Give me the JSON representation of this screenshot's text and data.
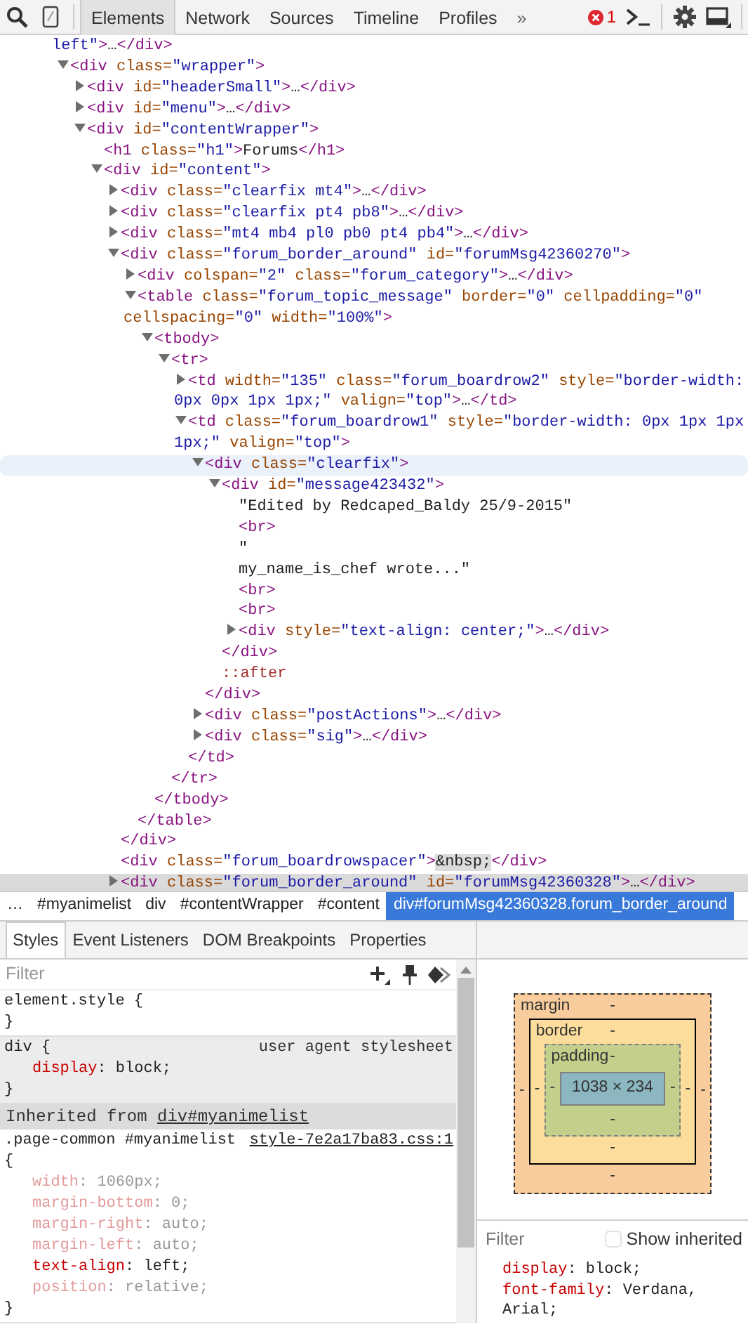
{
  "toolbar": {
    "tabs": [
      {
        "label": "Elements",
        "selected": true
      },
      {
        "label": "Network",
        "selected": false
      },
      {
        "label": "Sources",
        "selected": false
      },
      {
        "label": "Timeline",
        "selected": false
      },
      {
        "label": "Profiles",
        "selected": false
      }
    ],
    "overflow": "»",
    "error_count": "1"
  },
  "dom_tree": [
    {
      "kind": "fragment",
      "selected": false,
      "hovered": false,
      "parts": [
        {
          "kind": "value",
          "text": "left\""
        },
        {
          "kind": "tag",
          "text": ">"
        },
        {
          "kind": "ellipsis",
          "text": "…"
        },
        {
          "kind": "tag",
          "text": "</div>"
        }
      ]
    },
    {
      "kind": "element",
      "expanded": true,
      "selected": false,
      "hovered": false,
      "parts": [
        {
          "kind": "tag",
          "text": "<div"
        },
        {
          "kind": "attr",
          "text": " class="
        },
        {
          "kind": "value",
          "text": "\"wrapper\""
        },
        {
          "kind": "tag",
          "text": ">"
        }
      ],
      "children": [
        {
          "kind": "element",
          "expanded": false,
          "selected": false,
          "hovered": false,
          "parts": [
            {
              "kind": "tag",
              "text": "<div"
            },
            {
              "kind": "attr",
              "text": " id="
            },
            {
              "kind": "value",
              "text": "\"headerSmall\""
            },
            {
              "kind": "tag",
              "text": ">"
            },
            {
              "kind": "ellipsis",
              "text": "…"
            },
            {
              "kind": "tag",
              "text": "</div>"
            }
          ]
        },
        {
          "kind": "element",
          "expanded": false,
          "selected": false,
          "hovered": false,
          "parts": [
            {
              "kind": "tag",
              "text": "<div"
            },
            {
              "kind": "attr",
              "text": " id="
            },
            {
              "kind": "value",
              "text": "\"menu\""
            },
            {
              "kind": "tag",
              "text": ">"
            },
            {
              "kind": "ellipsis",
              "text": "…"
            },
            {
              "kind": "tag",
              "text": "</div>"
            }
          ]
        },
        {
          "kind": "element",
          "expanded": true,
          "selected": false,
          "hovered": false,
          "parts": [
            {
              "kind": "tag",
              "text": "<div"
            },
            {
              "kind": "attr",
              "text": " id="
            },
            {
              "kind": "value",
              "text": "\"contentWrapper\""
            },
            {
              "kind": "tag",
              "text": ">"
            }
          ],
          "children": [
            {
              "kind": "element",
              "selected": false,
              "hovered": false,
              "parts": [
                {
                  "kind": "tag",
                  "text": "<h1"
                },
                {
                  "kind": "attr",
                  "text": " class="
                },
                {
                  "kind": "value",
                  "text": "\"h1\""
                },
                {
                  "kind": "tag",
                  "text": ">"
                },
                {
                  "kind": "text",
                  "text": "Forums"
                },
                {
                  "kind": "tag",
                  "text": "</h1>"
                }
              ]
            },
            {
              "kind": "element",
              "expanded": true,
              "selected": false,
              "hovered": false,
              "parts": [
                {
                  "kind": "tag",
                  "text": "<div"
                },
                {
                  "kind": "attr",
                  "text": " id="
                },
                {
                  "kind": "value",
                  "text": "\"content\""
                },
                {
                  "kind": "tag",
                  "text": ">"
                }
              ],
              "children": [
                {
                  "kind": "element",
                  "expanded": false,
                  "selected": false,
                  "hovered": false,
                  "parts": [
                    {
                      "kind": "tag",
                      "text": "<div"
                    },
                    {
                      "kind": "attr",
                      "text": " class="
                    },
                    {
                      "kind": "value",
                      "text": "\"clearfix mt4\""
                    },
                    {
                      "kind": "tag",
                      "text": ">"
                    },
                    {
                      "kind": "ellipsis",
                      "text": "…"
                    },
                    {
                      "kind": "tag",
                      "text": "</div>"
                    }
                  ]
                },
                {
                  "kind": "element",
                  "expanded": false,
                  "selected": false,
                  "hovered": false,
                  "parts": [
                    {
                      "kind": "tag",
                      "text": "<div"
                    },
                    {
                      "kind": "attr",
                      "text": " class="
                    },
                    {
                      "kind": "value",
                      "text": "\"clearfix pt4 pb8\""
                    },
                    {
                      "kind": "tag",
                      "text": ">"
                    },
                    {
                      "kind": "ellipsis",
                      "text": "…"
                    },
                    {
                      "kind": "tag",
                      "text": "</div>"
                    }
                  ]
                },
                {
                  "kind": "element",
                  "expanded": false,
                  "selected": false,
                  "hovered": false,
                  "parts": [
                    {
                      "kind": "tag",
                      "text": "<div"
                    },
                    {
                      "kind": "attr",
                      "text": " class="
                    },
                    {
                      "kind": "value",
                      "text": "\"mt4 mb4 pl0 pb0 pt4 pb4\""
                    },
                    {
                      "kind": "tag",
                      "text": ">"
                    },
                    {
                      "kind": "ellipsis",
                      "text": "…"
                    },
                    {
                      "kind": "tag",
                      "text": "</div>"
                    }
                  ]
                },
                {
                  "kind": "element",
                  "expanded": true,
                  "selected": false,
                  "hovered": false,
                  "close": "</div>",
                  "parts": [
                    {
                      "kind": "tag",
                      "text": "<div"
                    },
                    {
                      "kind": "attr",
                      "text": " class="
                    },
                    {
                      "kind": "value",
                      "text": "\"forum_border_around\""
                    },
                    {
                      "kind": "attr",
                      "text": " id="
                    },
                    {
                      "kind": "value",
                      "text": "\"forumMsg42360270\""
                    },
                    {
                      "kind": "tag",
                      "text": ">"
                    }
                  ],
                  "children": [
                    {
                      "kind": "element",
                      "expanded": false,
                      "selected": false,
                      "hovered": false,
                      "parts": [
                        {
                          "kind": "tag",
                          "text": "<div"
                        },
                        {
                          "kind": "attr",
                          "text": " colspan="
                        },
                        {
                          "kind": "value",
                          "text": "\"2\""
                        },
                        {
                          "kind": "attr",
                          "text": " class="
                        },
                        {
                          "kind": "value",
                          "text": "\"forum_category\""
                        },
                        {
                          "kind": "tag",
                          "text": ">"
                        },
                        {
                          "kind": "ellipsis",
                          "text": "…"
                        },
                        {
                          "kind": "tag",
                          "text": "</div>"
                        }
                      ]
                    },
                    {
                      "kind": "element",
                      "expanded": true,
                      "selected": false,
                      "hovered": false,
                      "close": "</table>",
                      "parts": [
                        {
                          "kind": "tag",
                          "text": "<table"
                        },
                        {
                          "kind": "attr",
                          "text": " class="
                        },
                        {
                          "kind": "value",
                          "text": "\"forum_topic_message\""
                        },
                        {
                          "kind": "attr",
                          "text": " border="
                        },
                        {
                          "kind": "value",
                          "text": "\"0\""
                        },
                        {
                          "kind": "attr",
                          "text": " cellpadding="
                        },
                        {
                          "kind": "value",
                          "text": "\"0\""
                        },
                        {
                          "kind": "attr",
                          "text": "\ncellspacing="
                        },
                        {
                          "kind": "value",
                          "text": "\"0\""
                        },
                        {
                          "kind": "attr",
                          "text": " width="
                        },
                        {
                          "kind": "value",
                          "text": "\"100%\""
                        },
                        {
                          "kind": "tag",
                          "text": ">"
                        }
                      ],
                      "children": [
                        {
                          "kind": "element",
                          "expanded": true,
                          "selected": false,
                          "hovered": false,
                          "close": "</tbody>",
                          "parts": [
                            {
                              "kind": "tag",
                              "text": "<tbody>"
                            }
                          ],
                          "children": [
                            {
                              "kind": "element",
                              "expanded": true,
                              "selected": false,
                              "hovered": false,
                              "close": "</tr>",
                              "parts": [
                                {
                                  "kind": "tag",
                                  "text": "<tr>"
                                }
                              ],
                              "children": [
                                {
                                  "kind": "element",
                                  "expanded": false,
                                  "selected": false,
                                  "hovered": false,
                                  "parts": [
                                    {
                                      "kind": "tag",
                                      "text": "<td"
                                    },
                                    {
                                      "kind": "attr",
                                      "text": " width="
                                    },
                                    {
                                      "kind": "value",
                                      "text": "\"135\""
                                    },
                                    {
                                      "kind": "attr",
                                      "text": " class="
                                    },
                                    {
                                      "kind": "value",
                                      "text": "\"forum_boardrow2\""
                                    },
                                    {
                                      "kind": "attr",
                                      "text": " style="
                                    },
                                    {
                                      "kind": "value",
                                      "text": "\"border-width:\n0px 0px 1px 1px;\""
                                    },
                                    {
                                      "kind": "attr",
                                      "text": " valign="
                                    },
                                    {
                                      "kind": "value",
                                      "text": "\"top\""
                                    },
                                    {
                                      "kind": "tag",
                                      "text": ">"
                                    },
                                    {
                                      "kind": "ellipsis",
                                      "text": "…"
                                    },
                                    {
                                      "kind": "tag",
                                      "text": "</td>"
                                    }
                                  ]
                                },
                                {
                                  "kind": "element",
                                  "expanded": true,
                                  "selected": false,
                                  "hovered": false,
                                  "close": "</td>",
                                  "parts": [
                                    {
                                      "kind": "tag",
                                      "text": "<td"
                                    },
                                    {
                                      "kind": "attr",
                                      "text": " class="
                                    },
                                    {
                                      "kind": "value",
                                      "text": "\"forum_boardrow1\""
                                    },
                                    {
                                      "kind": "attr",
                                      "text": " style="
                                    },
                                    {
                                      "kind": "value",
                                      "text": "\"border-width: 0px 1px 1px\n1px;\""
                                    },
                                    {
                                      "kind": "attr",
                                      "text": " valign="
                                    },
                                    {
                                      "kind": "value",
                                      "text": "\"top\""
                                    },
                                    {
                                      "kind": "tag",
                                      "text": ">"
                                    }
                                  ],
                                  "children": [
                                    {
                                      "kind": "element",
                                      "expanded": true,
                                      "selected": false,
                                      "hovered": true,
                                      "close": "</div>",
                                      "parts": [
                                        {
                                          "kind": "tag",
                                          "text": "<div"
                                        },
                                        {
                                          "kind": "attr",
                                          "text": " class="
                                        },
                                        {
                                          "kind": "value",
                                          "text": "\"clearfix\""
                                        },
                                        {
                                          "kind": "tag",
                                          "text": ">"
                                        }
                                      ],
                                      "children": [
                                        {
                                          "kind": "element",
                                          "expanded": true,
                                          "selected": false,
                                          "hovered": false,
                                          "close": "</div>",
                                          "parts": [
                                            {
                                              "kind": "tag",
                                              "text": "<div"
                                            },
                                            {
                                              "kind": "attr",
                                              "text": " id="
                                            },
                                            {
                                              "kind": "value",
                                              "text": "\"message423432\""
                                            },
                                            {
                                              "kind": "tag",
                                              "text": ">"
                                            }
                                          ],
                                          "children": [
                                            {
                                              "kind": "text",
                                              "selected": false,
                                              "hovered": false,
                                              "parts": [
                                                {
                                                  "kind": "text",
                                                  "text": "\"Edited by Redcaped_Baldy 25/9-2015\""
                                                }
                                              ]
                                            },
                                            {
                                              "kind": "element",
                                              "selected": false,
                                              "hovered": false,
                                              "parts": [
                                                {
                                                  "kind": "tag",
                                                  "text": "<br>"
                                                }
                                              ]
                                            },
                                            {
                                              "kind": "text",
                                              "selected": false,
                                              "hovered": false,
                                              "parts": [
                                                {
                                                  "kind": "text",
                                                  "text": "\"\nmy_name_is_chef wrote...\""
                                                }
                                              ]
                                            },
                                            {
                                              "kind": "element",
                                              "selected": false,
                                              "hovered": false,
                                              "parts": [
                                                {
                                                  "kind": "tag",
                                                  "text": "<br>"
                                                }
                                              ]
                                            },
                                            {
                                              "kind": "element",
                                              "selected": false,
                                              "hovered": false,
                                              "parts": [
                                                {
                                                  "kind": "tag",
                                                  "text": "<br>"
                                                }
                                              ]
                                            },
                                            {
                                              "kind": "element",
                                              "expanded": false,
                                              "selected": false,
                                              "hovered": false,
                                              "parts": [
                                                {
                                                  "kind": "tag",
                                                  "text": "<div"
                                                },
                                                {
                                                  "kind": "attr",
                                                  "text": " style="
                                                },
                                                {
                                                  "kind": "value",
                                                  "text": "\"text-align: center;\""
                                                },
                                                {
                                                  "kind": "tag",
                                                  "text": ">"
                                                },
                                                {
                                                  "kind": "ellipsis",
                                                  "text": "…"
                                                },
                                                {
                                                  "kind": "tag",
                                                  "text": "</div>"
                                                }
                                              ]
                                            }
                                          ]
                                        },
                                        {
                                          "kind": "pseudo",
                                          "selected": false,
                                          "hovered": false,
                                          "parts": [
                                            {
                                              "kind": "pseudo",
                                              "text": "::after"
                                            }
                                          ]
                                        }
                                      ]
                                    },
                                    {
                                      "kind": "element",
                                      "expanded": false,
                                      "selected": false,
                                      "hovered": false,
                                      "parts": [
                                        {
                                          "kind": "tag",
                                          "text": "<div"
                                        },
                                        {
                                          "kind": "attr",
                                          "text": " class="
                                        },
                                        {
                                          "kind": "value",
                                          "text": "\"postActions\""
                                        },
                                        {
                                          "kind": "tag",
                                          "text": ">"
                                        },
                                        {
                                          "kind": "ellipsis",
                                          "text": "…"
                                        },
                                        {
                                          "kind": "tag",
                                          "text": "</div>"
                                        }
                                      ]
                                    },
                                    {
                                      "kind": "element",
                                      "expanded": false,
                                      "selected": false,
                                      "hovered": false,
                                      "parts": [
                                        {
                                          "kind": "tag",
                                          "text": "<div"
                                        },
                                        {
                                          "kind": "attr",
                                          "text": " class="
                                        },
                                        {
                                          "kind": "value",
                                          "text": "\"sig\""
                                        },
                                        {
                                          "kind": "tag",
                                          "text": ">"
                                        },
                                        {
                                          "kind": "ellipsis",
                                          "text": "…"
                                        },
                                        {
                                          "kind": "tag",
                                          "text": "</div>"
                                        }
                                      ]
                                    }
                                  ]
                                }
                              ]
                            }
                          ]
                        }
                      ]
                    }
                  ]
                },
                {
                  "kind": "element",
                  "selected": false,
                  "hovered": false,
                  "parts": [
                    {
                      "kind": "tag",
                      "text": "<div"
                    },
                    {
                      "kind": "attr",
                      "text": " class="
                    },
                    {
                      "kind": "value",
                      "text": "\"forum_boardrowspacer\""
                    },
                    {
                      "kind": "tag",
                      "text": ">"
                    },
                    {
                      "kind": "entity",
                      "text": "&nbsp;"
                    },
                    {
                      "kind": "tag",
                      "text": "</div>"
                    }
                  ]
                },
                {
                  "kind": "element",
                  "expanded": false,
                  "selected": true,
                  "hovered": false,
                  "parts": [
                    {
                      "kind": "tag",
                      "text": "<div"
                    },
                    {
                      "kind": "attr",
                      "text": " class="
                    },
                    {
                      "kind": "value",
                      "text": "\"forum_border_around\""
                    },
                    {
                      "kind": "attr",
                      "text": " id="
                    },
                    {
                      "kind": "value",
                      "text": "\"forumMsg42360328\""
                    },
                    {
                      "kind": "tag",
                      "text": ">"
                    },
                    {
                      "kind": "ellipsis",
                      "text": "…"
                    },
                    {
                      "kind": "tag",
                      "text": "</div>"
                    }
                  ]
                }
              ]
            }
          ]
        }
      ]
    }
  ],
  "breadcrumbs": [
    {
      "label": "…",
      "selected": false
    },
    {
      "label": "#myanimelist",
      "selected": false
    },
    {
      "label": "div",
      "selected": false
    },
    {
      "label": "#contentWrapper",
      "selected": false
    },
    {
      "label": "#content",
      "selected": false
    },
    {
      "label": "div#forumMsg42360328.forum_border_around",
      "selected": true
    }
  ],
  "sidebar_tabs": [
    {
      "label": "Styles",
      "selected": true
    },
    {
      "label": "Event Listeners",
      "selected": false
    },
    {
      "label": "DOM Breakpoints",
      "selected": false
    },
    {
      "label": "Properties",
      "selected": false
    }
  ],
  "styles_filter": {
    "placeholder": "Filter"
  },
  "style_sections": [
    {
      "kind": "rule",
      "selector": "element.style",
      "open_brace": "{",
      "close_brace": "}",
      "shaded": false
    },
    {
      "kind": "rule",
      "selector": "div",
      "origin": "user agent stylesheet",
      "open_brace": "{",
      "close_brace": "}",
      "shaded": true,
      "properties": [
        {
          "name": "display",
          "value": ": block;",
          "overridden": false
        }
      ]
    },
    {
      "kind": "inherited",
      "label": "Inherited from",
      "link": "div#myanimelist"
    },
    {
      "kind": "rule",
      "selector": ".page-common #myanimelist",
      "source": "style-7e2a17ba83.css:1",
      "open_brace": "{",
      "close_brace": "}",
      "shaded": false,
      "properties": [
        {
          "name": "width",
          "value": ": 1060px;",
          "overridden": true
        },
        {
          "name": "margin-bottom",
          "value": ": 0;",
          "overridden": true
        },
        {
          "name": "margin-right",
          "value": ": auto;",
          "overridden": true
        },
        {
          "name": "margin-left",
          "value": ": auto;",
          "overridden": true
        },
        {
          "name": "text-align",
          "value": ": left;",
          "overridden": false
        },
        {
          "name": "position",
          "value": ": relative;",
          "overridden": true
        }
      ]
    }
  ],
  "box_model": {
    "margin": {
      "label": "margin",
      "top": "-",
      "right": "-",
      "bottom": "-",
      "left": "-"
    },
    "border": {
      "label": "border",
      "top": "-",
      "right": "-",
      "bottom": "-",
      "left": "-"
    },
    "padding": {
      "label": "padding",
      "top": "-",
      "right": "-",
      "bottom": "-",
      "left": "-"
    },
    "content": "1038 × 234"
  },
  "computed": {
    "filter_placeholder": "Filter",
    "show_inherited": {
      "label": "Show inherited",
      "checked": false
    },
    "properties": [
      {
        "name": "display",
        "value": ": block;"
      },
      {
        "name": "font-family",
        "value": ": Verdana, Arial;"
      }
    ]
  }
}
